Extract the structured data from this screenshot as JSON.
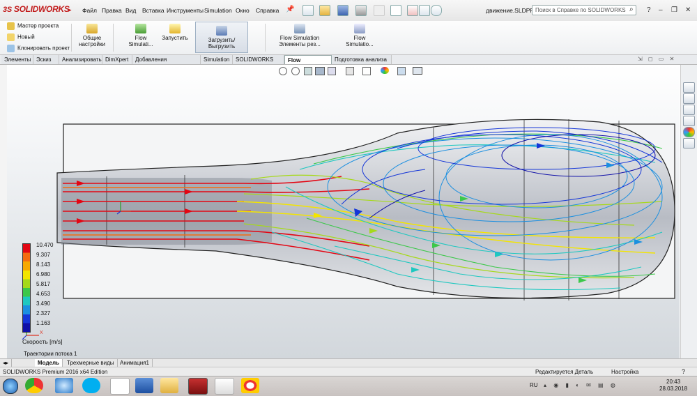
{
  "app": {
    "logo_text": "SOLIDWORKS",
    "document_title": "движение.SLDPRT"
  },
  "menu": [
    "Файл",
    "Правка",
    "Вид",
    "Вставка",
    "Инструменты",
    "Simulation",
    "Окно",
    "Справка"
  ],
  "help_search": {
    "placeholder": "Поиск в Справке по SOLIDWORKS"
  },
  "command_manager": {
    "project_group": [
      "Мастер проекта",
      "Новый",
      "Клонировать проект"
    ],
    "general_settings": "Общие настройки",
    "flow_simulation_1": "Flow Simulati...",
    "run": "Запустить",
    "upload": "Загрузить/Выгрузить",
    "flow_elements": "Flow Simulation Элементы рез...",
    "flow_simulation_2": "Flow Simulatio..."
  },
  "tabs": [
    "Элементы",
    "Эскиз",
    "Анализировать",
    "DimXpert",
    "Добавления SOLIDWORKS",
    "Simulation",
    "SOLIDWORKS MBD",
    "Flow Simulation",
    "Подготовка анализа"
  ],
  "active_tab": "Flow Simulation",
  "legend": {
    "values": [
      "10.470",
      "9.307",
      "8.143",
      "6.980",
      "5.817",
      "4.653",
      "3.490",
      "2.327",
      "1.163"
    ],
    "colors": [
      "#e30613",
      "#f46b10",
      "#f6a800",
      "#f3e500",
      "#a6d91a",
      "#3cc84a",
      "#1ec8c0",
      "#1b8fe0",
      "#1536d8",
      "#1010a8"
    ],
    "title": "Скорость [m/s]"
  },
  "plot_label": "Траектории потока 1",
  "bottom_tabs": [
    "Модель",
    "Трехмерные виды",
    "Анимация1"
  ],
  "active_bottom_tab": "Модель",
  "status": {
    "edition": "SOLIDWORKS Premium 2016 x64 Edition",
    "editing": "Редактируется Деталь",
    "settings": "Настройка"
  },
  "taskbar": {
    "language": "RU",
    "time": "20:43",
    "date": "28.03.2018"
  }
}
